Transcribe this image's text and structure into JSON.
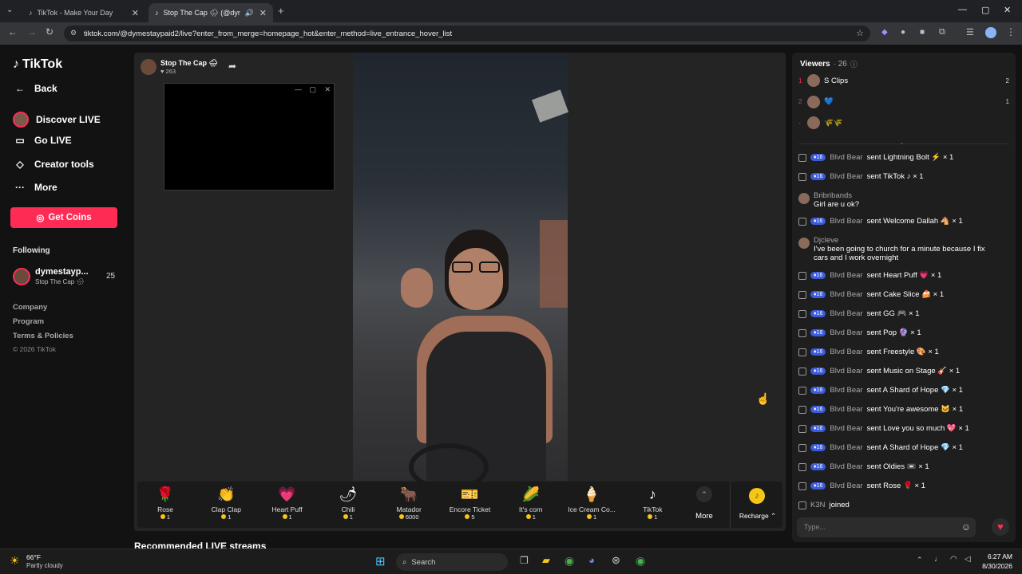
{
  "browser": {
    "tabs": [
      {
        "title": "TikTok - Make Your Day"
      },
      {
        "title": "Stop The Cap 🌧 (@dyme"
      }
    ],
    "url": "tiktok.com/@dymestaypaid2/live?enter_from_merge=homepage_hot&enter_method=live_entrance_hover_list"
  },
  "sidebar": {
    "logo": "TikTok",
    "nav": [
      {
        "label": "Back",
        "icon": "back-arrow-icon"
      },
      {
        "label": "Discover LIVE",
        "icon": "live-avatar-icon"
      },
      {
        "label": "Go LIVE",
        "icon": "camera-icon"
      },
      {
        "label": "Creator tools",
        "icon": "lightbulb-icon"
      },
      {
        "label": "More",
        "icon": "ellipsis-icon"
      }
    ],
    "get_coins": "Get Coins",
    "following_title": "Following",
    "following": [
      {
        "name": "dymestayp...",
        "sub": "Stop The Cap 🌧",
        "count": "25"
      }
    ],
    "footer": [
      "Company",
      "Program",
      "Terms & Policies",
      "© 2026 TikTok"
    ]
  },
  "stream": {
    "host_name": "Stop The Cap 🌧",
    "likes": "263"
  },
  "gifts": [
    {
      "name": "Rose",
      "price": "1",
      "icon": "🌹"
    },
    {
      "name": "Clap Clap",
      "price": "1",
      "icon": "👏"
    },
    {
      "name": "Heart Puff",
      "price": "1",
      "icon": "💗"
    },
    {
      "name": "Chili",
      "price": "1",
      "icon": "🌶"
    },
    {
      "name": "Matador",
      "price": "6000",
      "icon": "🐂"
    },
    {
      "name": "Encore Ticket",
      "price": "5",
      "icon": "🎫"
    },
    {
      "name": "It's corn",
      "price": "1",
      "icon": "🌽"
    },
    {
      "name": "Ice Cream Co...",
      "price": "1",
      "icon": "🍦"
    },
    {
      "name": "TikTok",
      "price": "1",
      "icon": "♪"
    }
  ],
  "gift_more": "More",
  "recharge": "Recharge",
  "recommended": "Recommended LIVE streams",
  "chat": {
    "viewers_title": "Viewers",
    "viewers_count": "· 26",
    "top_viewers": [
      {
        "rank": "1",
        "name": "S Clips",
        "score": "2"
      },
      {
        "rank": "2",
        "name": "💙",
        "score": "1"
      },
      {
        "rank": "-",
        "name": "🌾🌾",
        "score": ""
      }
    ],
    "messages": [
      {
        "type": "gift",
        "level": "16",
        "user": "Blvd Bear",
        "text": "sent Lightning Bolt ⚡ × 1"
      },
      {
        "type": "gift",
        "level": "16",
        "user": "Blvd Bear",
        "text": "sent TikTok ♪ × 1"
      },
      {
        "type": "comment",
        "user": "Bribribands",
        "text": "Girl are u ok?"
      },
      {
        "type": "gift",
        "level": "16",
        "user": "Blvd Bear",
        "text": "sent Welcome Dallah 🐴 × 1"
      },
      {
        "type": "comment",
        "user": "Djcleve",
        "text": "I've been going to church for a minute because I fix cars and I work overnight"
      },
      {
        "type": "gift",
        "level": "16",
        "user": "Blvd Bear",
        "text": "sent Heart Puff 💗 × 1"
      },
      {
        "type": "gift",
        "level": "16",
        "user": "Blvd Bear",
        "text": "sent Cake Slice 🍰 × 1"
      },
      {
        "type": "gift",
        "level": "16",
        "user": "Blvd Bear",
        "text": "sent GG 🎮 × 1"
      },
      {
        "type": "gift",
        "level": "16",
        "user": "Blvd Bear",
        "text": "sent Pop 🔮 × 1"
      },
      {
        "type": "gift",
        "level": "16",
        "user": "Blvd Bear",
        "text": "sent Freestyle 🎨 × 1"
      },
      {
        "type": "gift",
        "level": "16",
        "user": "Blvd Bear",
        "text": "sent Music on Stage 🎸 × 1"
      },
      {
        "type": "gift",
        "level": "16",
        "user": "Blvd Bear",
        "text": "sent A Shard of Hope 💎 × 1"
      },
      {
        "type": "gift",
        "level": "16",
        "user": "Blvd Bear",
        "text": "sent You're awesome 🐱 × 1"
      },
      {
        "type": "gift",
        "level": "16",
        "user": "Blvd Bear",
        "text": "sent Love you so much 💖 × 1"
      },
      {
        "type": "gift",
        "level": "16",
        "user": "Blvd Bear",
        "text": "sent A Shard of Hope 💎 × 1"
      },
      {
        "type": "gift",
        "level": "16",
        "user": "Blvd Bear",
        "text": "sent Oldies 📼 × 1"
      },
      {
        "type": "gift",
        "level": "16",
        "user": "Blvd Bear",
        "text": "sent Rose 🌹 × 1"
      },
      {
        "type": "join",
        "user": "K3N",
        "text": "joined"
      }
    ],
    "input_placeholder": "Type..."
  },
  "taskbar": {
    "weather_temp": "66°F",
    "weather_desc": "Partly cloudy",
    "search": "Search",
    "time": "6:27 AM",
    "date": "8/30/2026"
  }
}
